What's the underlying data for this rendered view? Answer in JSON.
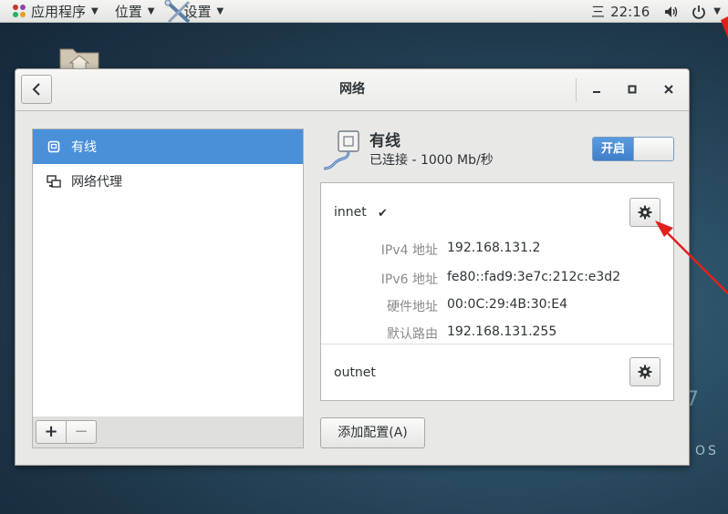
{
  "topbar": {
    "apps_label": "应用程序",
    "places_label": "位置",
    "settings_label": "设置",
    "input_method": "三",
    "clock": "22:16"
  },
  "desktop": {
    "seven_text": "7",
    "os_text": "OS"
  },
  "window": {
    "title": "网络"
  },
  "sidebar": {
    "items": [
      {
        "label": "有线",
        "icon": "wired-network-icon",
        "selected": true
      },
      {
        "label": "网络代理",
        "icon": "proxy-icon",
        "selected": false
      }
    ],
    "add_label": "+",
    "remove_label": "−"
  },
  "wired": {
    "title": "有线",
    "status": "已连接 - 1000 Mb/秒",
    "switch_label": "开启",
    "switch_on": true
  },
  "connections": [
    {
      "name": "innet",
      "active_mark": "✔",
      "details": [
        {
          "label": "IPv4 地址",
          "value": "192.168.131.2"
        },
        {
          "label": "IPv6 地址",
          "value": "fe80::fad9:3e7c:212c:e3d2"
        },
        {
          "label": "硬件地址",
          "value": "00:0C:29:4B:30:E4"
        },
        {
          "label": "默认路由",
          "value": "192.168.131.255"
        }
      ]
    },
    {
      "name": "outnet"
    }
  ],
  "add_profile_label": "添加配置(A)",
  "colors": {
    "accent": "#4a90d9",
    "annotation_arrow": "#e0201b"
  }
}
